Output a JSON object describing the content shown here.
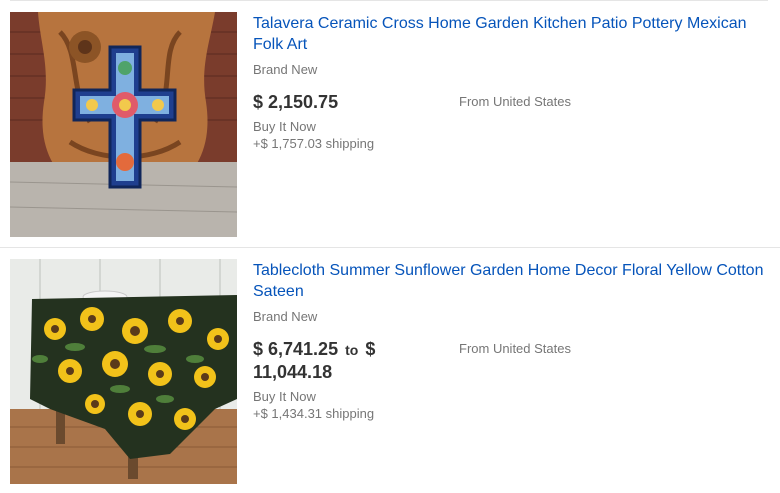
{
  "listings": [
    {
      "title": "Talavera Ceramic Cross Home Garden Kitchen Patio Pottery Mexican Folk Art",
      "condition": "Brand New",
      "price": "$ 2,150.75",
      "format": "Buy It Now",
      "shipping": "+$ 1,757.03 shipping",
      "location": "From United States"
    },
    {
      "title": "Tablecloth Summer Sunflower Garden Home Decor Floral Yellow Cotton Sateen",
      "condition": "Brand New",
      "price_low": "$ 6,741.25",
      "price_sep": "to",
      "price_high": "$ 11,044.18",
      "format": "Buy It Now",
      "shipping": "+$ 1,434.31 shipping",
      "location": "From United States"
    }
  ],
  "colors": {
    "link": "#0654ba",
    "text": "#333333",
    "muted": "#767676",
    "divider": "#e5e5e5"
  }
}
